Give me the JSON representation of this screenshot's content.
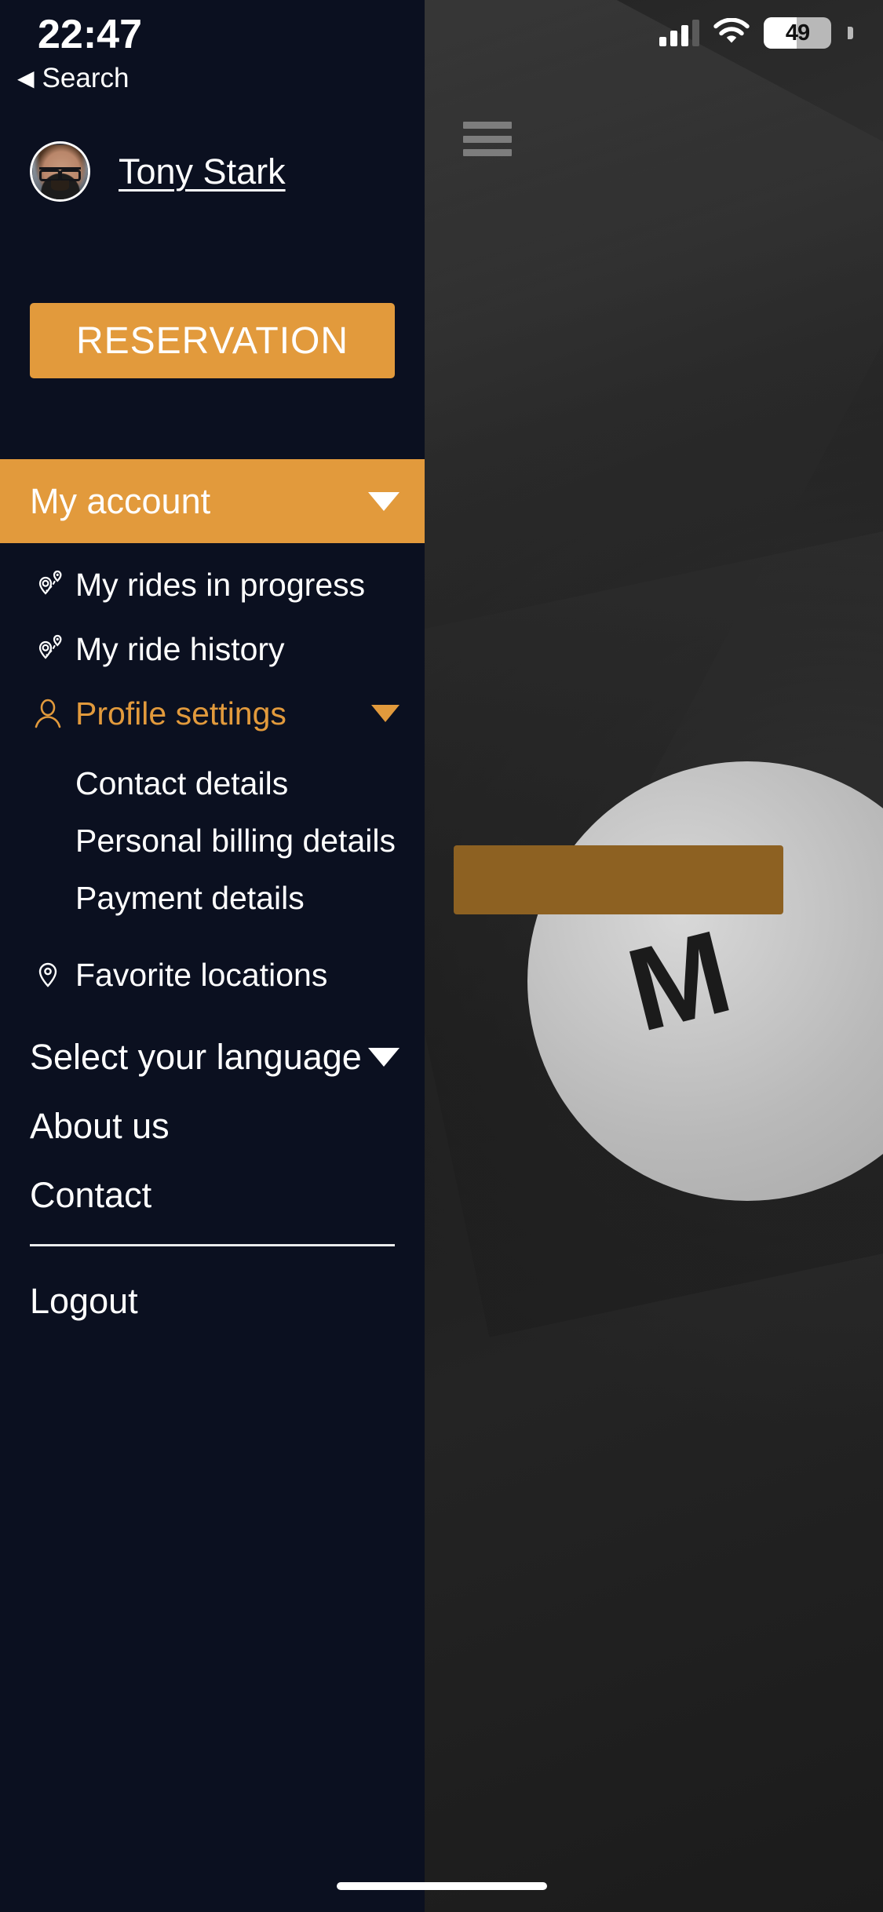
{
  "status_bar": {
    "time": "22:47",
    "back_label": "Search",
    "back_arrow": "◀",
    "battery_percent": "49",
    "battery_level": 49,
    "signal_icon": "cellular-bars-icon",
    "wifi_icon": "wifi-icon"
  },
  "background": {
    "menu_icon": "hamburger-menu-icon",
    "logo_text": "M",
    "orange_button_color": "#8d6122"
  },
  "drawer": {
    "background_color": "#0b1020",
    "accent_color": "#e29a3c",
    "profile": {
      "avatar_name": "avatar",
      "user_name": "Tony Stark"
    },
    "reservation_button": "RESERVATION",
    "account_header": {
      "label": "My account",
      "caret_icon": "chevron-down-icon"
    },
    "menu_items": [
      {
        "label": "My rides in progress",
        "icon": "route-pin-icon",
        "active": false
      },
      {
        "label": "My ride history",
        "icon": "route-pin-icon",
        "active": false
      },
      {
        "label": "Profile settings",
        "icon": "user-outline-icon",
        "active": true,
        "caret_icon": "chevron-down-icon"
      }
    ],
    "sub_items": [
      {
        "label": "Contact details"
      },
      {
        "label": "Personal billing details"
      },
      {
        "label": "Payment details"
      }
    ],
    "favorite_locations": {
      "label": "Favorite locations",
      "icon": "map-pin-icon"
    },
    "language_selector": {
      "label": "Select your language",
      "caret_icon": "chevron-down-icon"
    },
    "about_us": "About us",
    "contact": "Contact",
    "logout": "Logout"
  }
}
